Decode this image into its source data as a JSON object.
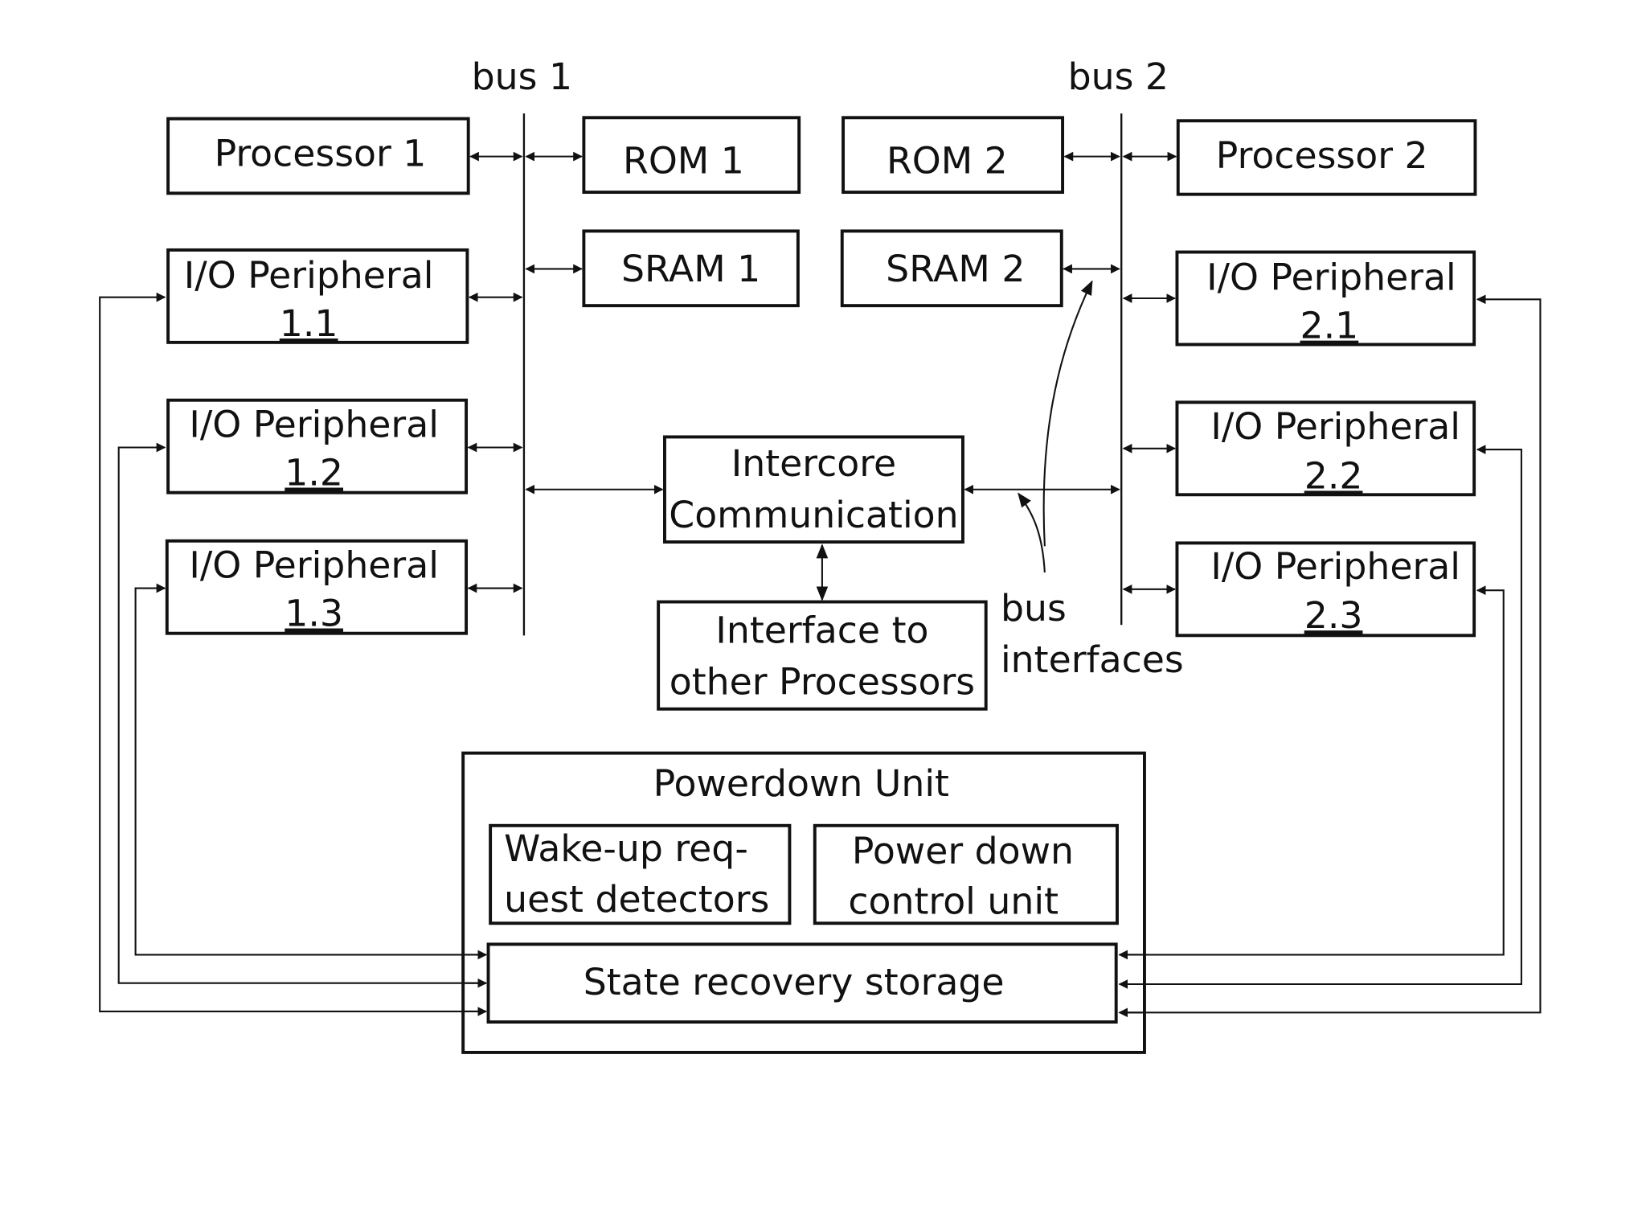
{
  "diagram": {
    "buses": [
      {
        "id": "bus1",
        "label": "bus 1"
      },
      {
        "id": "bus2",
        "label": "bus 2"
      }
    ],
    "left": {
      "processor": "Processor 1",
      "rom": "ROM 1",
      "sram": "SRAM 1",
      "peripherals": [
        {
          "line1": "I/O Peripheral",
          "line2": "1.1"
        },
        {
          "line1": "I/O Peripheral",
          "line2": "1.2"
        },
        {
          "line1": "I/O Peripheral",
          "line2": "1.3"
        }
      ]
    },
    "right": {
      "processor": "Processor 2",
      "rom": "ROM 2",
      "sram": "SRAM 2",
      "peripherals": [
        {
          "line1": "I/O Peripheral",
          "line2": "2.1"
        },
        {
          "line1": "I/O Peripheral",
          "line2": "2.2"
        },
        {
          "line1": "I/O Peripheral",
          "line2": "2.3"
        }
      ]
    },
    "intercore": {
      "line1": "Intercore",
      "line2": "Communication"
    },
    "interface": {
      "line1": "Interface to",
      "line2": "other Processors"
    },
    "bus_interfaces": {
      "line1": "bus",
      "line2": "interfaces"
    },
    "powerdown": {
      "title": "Powerdown Unit",
      "wakeup": {
        "line1": "Wake-up req-",
        "line2": "uest detectors"
      },
      "control": {
        "line1": "Power down",
        "line2": "control unit"
      },
      "storage": "State recovery storage"
    }
  }
}
